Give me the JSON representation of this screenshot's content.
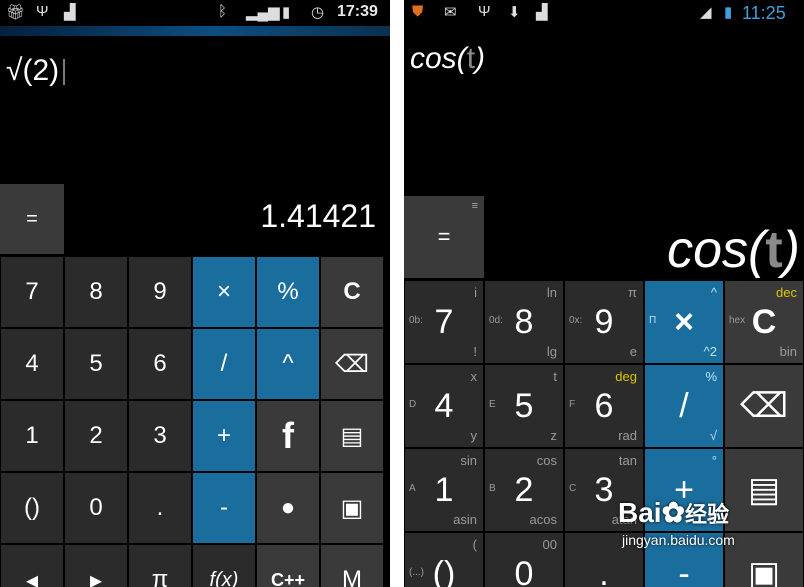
{
  "left": {
    "status": {
      "time": "17:39",
      "icons": [
        "gift-icon",
        "usb-icon",
        "android-icon",
        "bluetooth-icon",
        "signal-icon",
        "battery-icon",
        "clock-icon"
      ]
    },
    "expression": "√(2)",
    "equals_label": "=",
    "result": "1.41421",
    "keys": [
      [
        "7",
        "8",
        "9",
        "×",
        "%",
        "C"
      ],
      [
        "4",
        "5",
        "6",
        "/",
        "^",
        "⌫"
      ],
      [
        "1",
        "2",
        "3",
        "+",
        "f",
        "▤"
      ],
      [
        "()",
        "0",
        ".",
        "-",
        "●",
        "▣"
      ],
      [
        "◂",
        "▸",
        "π",
        "f(x)",
        "C++",
        "M"
      ]
    ],
    "colors": {
      "blue_key": "#1a6e9e",
      "key": "#2b2b2b",
      "equals": "#3a3a3a"
    }
  },
  "right": {
    "status": {
      "time": "11:25",
      "icons": [
        "notification-icon",
        "mail-icon",
        "usb-icon",
        "download-icon",
        "android-icon",
        "signal-icon",
        "battery-icon"
      ]
    },
    "expression_func": "cos(",
    "expression_var": "t",
    "expression_close": ")",
    "equals_label": "=",
    "result_func": "cos(",
    "result_var": "t",
    "result_close": ")",
    "keys": [
      [
        {
          "main": "7",
          "left": "0b:",
          "tr": "i",
          "br": "!"
        },
        {
          "main": "8",
          "left": "0d:",
          "tr": "ln",
          "br": "lg"
        },
        {
          "main": "9",
          "left": "0x:",
          "tr": "π",
          "br": "e"
        },
        {
          "main": "×",
          "left": "Π",
          "tr": "^",
          "br": "^2"
        },
        {
          "main": "C",
          "left": "hex",
          "tr": "dec",
          "br": "bin"
        }
      ],
      [
        {
          "main": "4",
          "left": "D",
          "tr": "x",
          "br": "y"
        },
        {
          "main": "5",
          "left": "E",
          "tr": "t",
          "br": "z"
        },
        {
          "main": "6",
          "left": "F",
          "tr": "deg",
          "br": "rad"
        },
        {
          "main": "/",
          "left": "",
          "tr": "%",
          "br": "√"
        },
        {
          "main": "⌫",
          "left": "",
          "tr": "",
          "br": ""
        }
      ],
      [
        {
          "main": "1",
          "left": "A",
          "tr": "sin",
          "br": "asin"
        },
        {
          "main": "2",
          "left": "B",
          "tr": "cos",
          "br": "acos"
        },
        {
          "main": "3",
          "left": "C",
          "tr": "tan",
          "br": "atan"
        },
        {
          "main": "+",
          "left": "",
          "tr": "°",
          "br": "E"
        },
        {
          "main": "▤",
          "left": "",
          "tr": "",
          "br": ""
        }
      ],
      [
        {
          "main": "()",
          "left": "(...)",
          "tr": "(",
          "br": ""
        },
        {
          "main": "0",
          "left": "",
          "tr": "00",
          "br": ""
        },
        {
          "main": ".",
          "left": "",
          "tr": "",
          "br": ""
        },
        {
          "main": "-",
          "left": "",
          "tr": "",
          "br": ""
        },
        {
          "main": "▣",
          "left": "",
          "tr": "",
          "br": ""
        }
      ]
    ],
    "colors": {
      "blue_key": "#1a6e9e",
      "deg_label": "#d8c600"
    }
  },
  "watermark": {
    "brand": "Bai",
    "brand2": "经验",
    "url": "jingyan.baidu.com"
  }
}
